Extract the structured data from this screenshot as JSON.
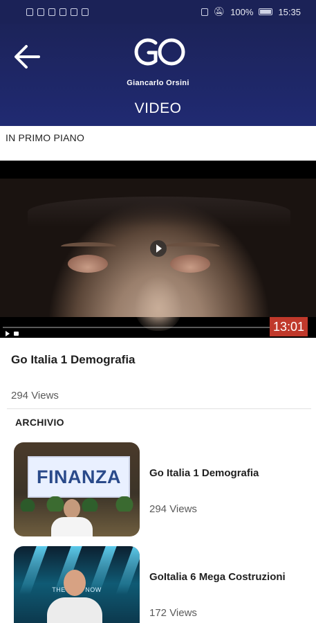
{
  "status_bar": {
    "battery_percent": "100%",
    "time": "15:35"
  },
  "header": {
    "brand_name": "Giancarlo Orsini",
    "page_title": "VIDEO",
    "logo_text": "GO",
    "colors": {
      "background": "#1c2359",
      "text": "#ffffff"
    }
  },
  "featured": {
    "section_label": "IN PRIMO PIANO",
    "duration": "13:01",
    "progress_fraction": 0.0,
    "title": "Go Italia  1 Demografia",
    "views": "294 Views"
  },
  "archive": {
    "section_label": "ARCHIVIO",
    "items": [
      {
        "title": "Go Italia  1 Demografia",
        "views": "294 Views",
        "thumbnail_text": "FINANZA"
      },
      {
        "title": "GoItalia 6 Mega Costruzioni",
        "views": "172 Views",
        "thumbnail_text": "THE FU        S NOW"
      }
    ]
  },
  "icons": [
    "back-arrow-icon",
    "play-icon",
    "notification-off-icon",
    "nfc-icon",
    "battery-icon"
  ],
  "accent_colors": {
    "duration_badge": "#c0392b",
    "progress": "#e52d27"
  }
}
